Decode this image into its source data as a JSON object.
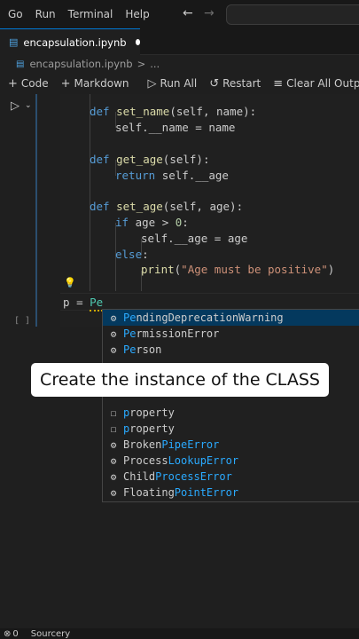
{
  "menu": {
    "items": [
      "Go",
      "Run",
      "Terminal",
      "Help"
    ]
  },
  "tab": {
    "title": "encapsulation.ipynb"
  },
  "breadcrumb": {
    "file": "encapsulation.ipynb",
    "separator": ">",
    "ellipsis": "..."
  },
  "toolbar": {
    "code_label": "Code",
    "markdown_label": "Markdown",
    "run_all_label": "Run All",
    "restart_label": "Restart",
    "clear_label": "Clear All Outputs"
  },
  "code": {
    "l1": {
      "kw": "def",
      "fn": "set_name",
      "args": "(self, name):"
    },
    "l2": {
      "text": "self.__name = name"
    },
    "l3": {
      "kw": "def",
      "fn": "get_age",
      "args": "(self):"
    },
    "l4": {
      "kw": "return",
      "text": "self.__age"
    },
    "l5": {
      "kw": "def",
      "fn": "set_age",
      "args": "(self, age):"
    },
    "l6": {
      "kw": "if",
      "text": "age >",
      "num": "0",
      "colon": ":"
    },
    "l7": {
      "text": "self.__age = age"
    },
    "l8": {
      "kw": "else",
      "colon": ":"
    },
    "l9": {
      "fn": "print",
      "open": "(",
      "str": "\"Age must be positive\"",
      "close": ")"
    },
    "input": {
      "var": "p",
      "op": "=",
      "typed": "Pe"
    }
  },
  "exec_count": "[ ]",
  "suggestions": {
    "items": [
      {
        "icon": "class-icon",
        "prefix": "Pe",
        "rest": "ndingDeprecationWarning",
        "selected": true
      },
      {
        "icon": "class-icon",
        "prefix": "Pe",
        "rest": "rmissionError",
        "selected": false
      },
      {
        "icon": "class-icon",
        "prefix": "Pe",
        "rest": "rson",
        "selected": false
      },
      {
        "icon": "property-icon",
        "prefix": "p",
        "rest": "roperty",
        "selected": false
      },
      {
        "icon": "property-icon",
        "prefix": "p",
        "rest": "roperty",
        "selected": false
      },
      {
        "icon": "class-icon",
        "prefix": "Broken",
        "rest": "PipeError",
        "selected": false
      },
      {
        "icon": "class-icon",
        "prefix": "Process",
        "rest": "LookupError",
        "selected": false
      },
      {
        "icon": "class-icon",
        "prefix": "Child",
        "rest": "ProcessError",
        "selected": false
      },
      {
        "icon": "class-icon",
        "prefix": "Floating",
        "rest": "PointError",
        "selected": false
      }
    ]
  },
  "caption": "Create the instance of the CLASS",
  "status": {
    "left": "0",
    "source": "Sourcery"
  },
  "colors": {
    "accent": "#0078d4",
    "selection": "#04395e",
    "match": "#2aaaff"
  }
}
